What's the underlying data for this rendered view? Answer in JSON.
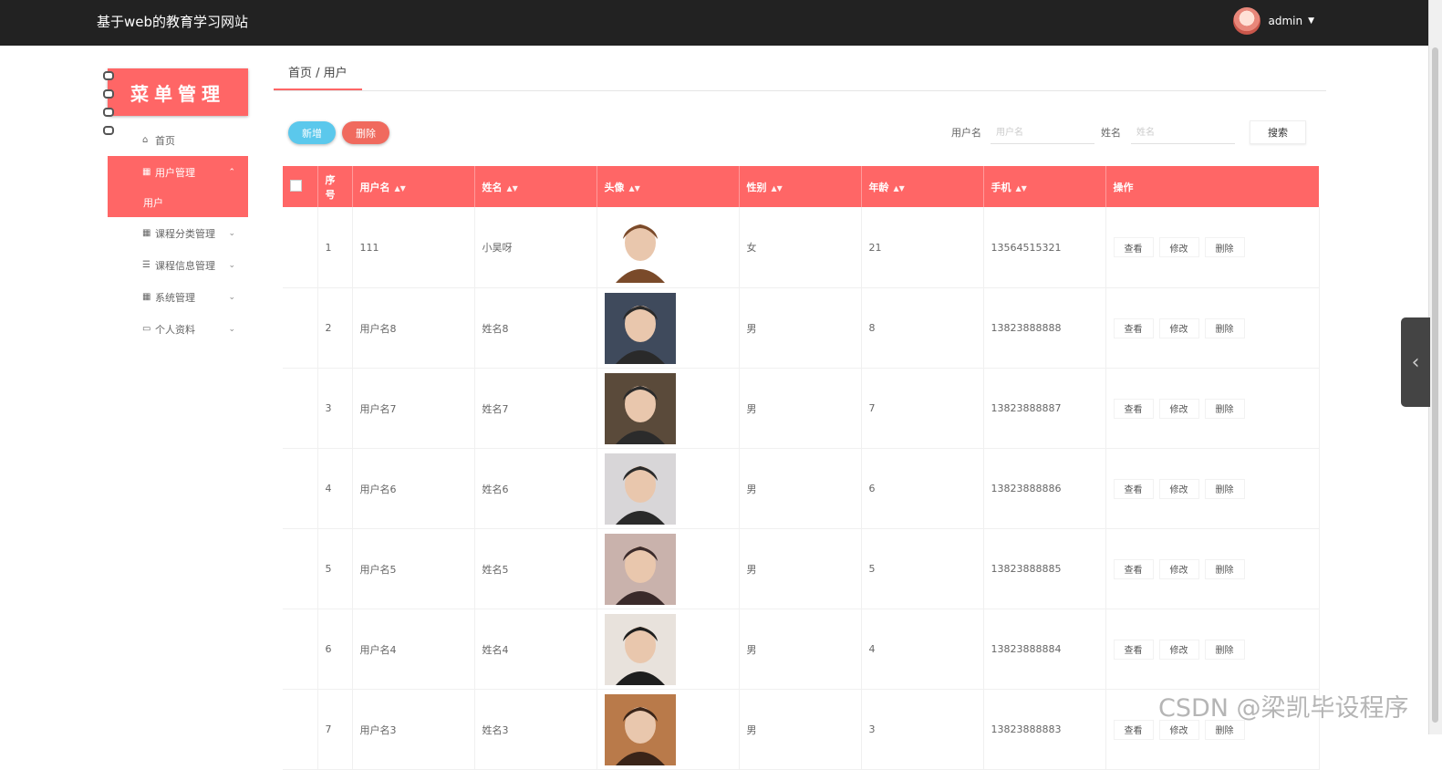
{
  "app": {
    "title": "基于web的教育学习网站",
    "user": "admin"
  },
  "menu": {
    "header": "菜单管理",
    "items": [
      {
        "label": "首页",
        "icon": "home-icon"
      },
      {
        "label": "用户管理",
        "icon": "grid-icon",
        "active": true,
        "sub": "用户"
      },
      {
        "label": "课程分类管理",
        "icon": "grid-icon"
      },
      {
        "label": "课程信息管理",
        "icon": "list-icon"
      },
      {
        "label": "系统管理",
        "icon": "grid-icon"
      },
      {
        "label": "个人资料",
        "icon": "card-icon"
      }
    ]
  },
  "breadcrumb": "首页 / 用户",
  "toolbar": {
    "add": "新增",
    "delete": "删除"
  },
  "search": {
    "username_label": "用户名",
    "username_placeholder": "用户名",
    "name_label": "姓名",
    "name_placeholder": "姓名",
    "button": "搜索"
  },
  "table": {
    "headers": [
      "序号",
      "用户名",
      "姓名",
      "头像",
      "性别",
      "年龄",
      "手机",
      "操作"
    ],
    "actions": [
      "查看",
      "修改",
      "删除"
    ],
    "rows": [
      {
        "no": "1",
        "username": "111",
        "name": "小昊呀",
        "gender": "女",
        "age": "21",
        "phone": "13564515321",
        "avatar_colors": [
          "#ffffff",
          "#7a4a2a"
        ]
      },
      {
        "no": "2",
        "username": "用户名8",
        "name": "姓名8",
        "gender": "男",
        "age": "8",
        "phone": "13823888888",
        "avatar_colors": [
          "#3f4a5c",
          "#2a2a2a"
        ]
      },
      {
        "no": "3",
        "username": "用户名7",
        "name": "姓名7",
        "gender": "男",
        "age": "7",
        "phone": "13823888887",
        "avatar_colors": [
          "#5a4a3a",
          "#2b2b2b"
        ]
      },
      {
        "no": "4",
        "username": "用户名6",
        "name": "姓名6",
        "gender": "男",
        "age": "6",
        "phone": "13823888886",
        "avatar_colors": [
          "#d8d6d8",
          "#2a2a2a"
        ]
      },
      {
        "no": "5",
        "username": "用户名5",
        "name": "姓名5",
        "gender": "男",
        "age": "5",
        "phone": "13823888885",
        "avatar_colors": [
          "#c9b2ac",
          "#3a2a2a"
        ]
      },
      {
        "no": "6",
        "username": "用户名4",
        "name": "姓名4",
        "gender": "男",
        "age": "4",
        "phone": "13823888884",
        "avatar_colors": [
          "#e8e2dc",
          "#1e1e1e"
        ]
      },
      {
        "no": "7",
        "username": "用户名3",
        "name": "姓名3",
        "gender": "男",
        "age": "3",
        "phone": "13823888883",
        "avatar_colors": [
          "#b97a4a",
          "#3a2418"
        ]
      }
    ]
  },
  "watermark": "CSDN @梁凯毕设程序",
  "colors": {
    "accent": "#ff6666",
    "topbar": "#222222",
    "add_button": "#5bc8ec"
  }
}
